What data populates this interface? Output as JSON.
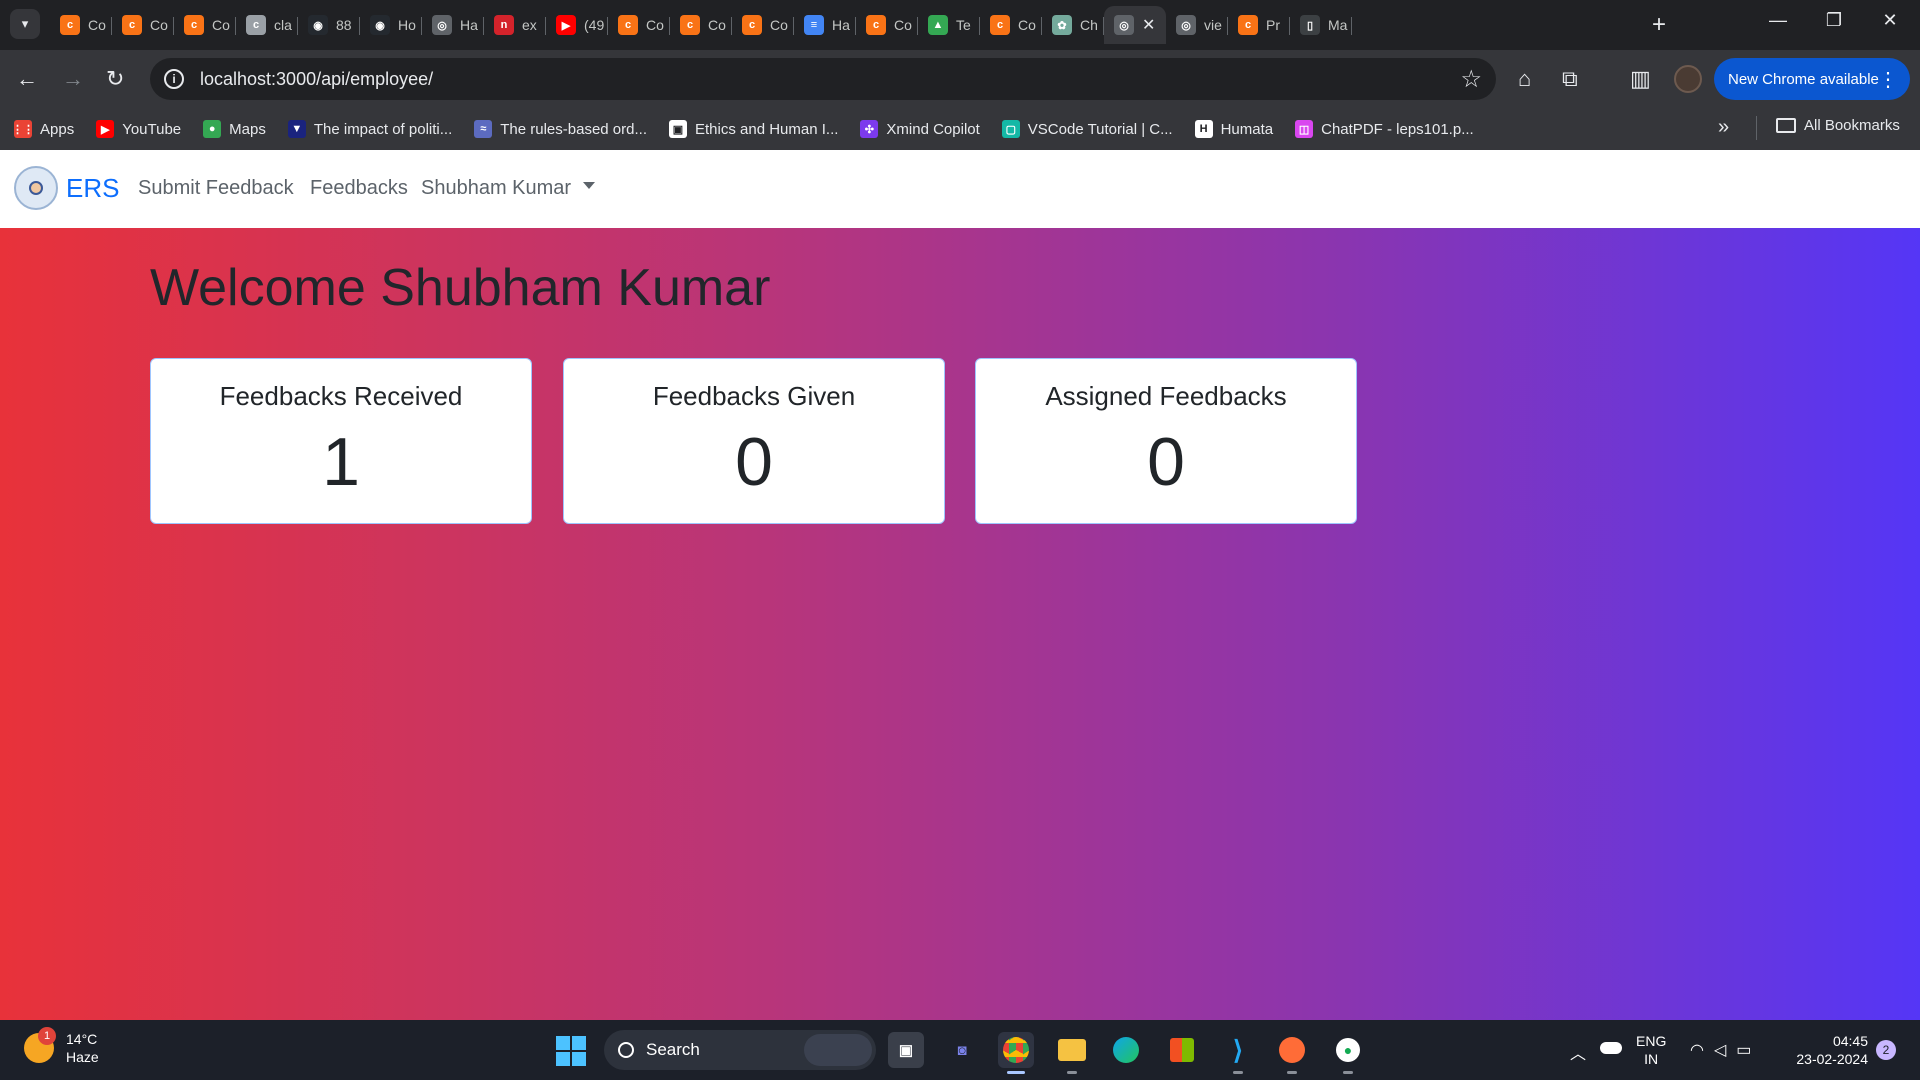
{
  "browser": {
    "tabs": [
      {
        "label": "Co",
        "fav_color": "#f97316",
        "fav_glyph": "c"
      },
      {
        "label": "Co",
        "fav_color": "#f97316",
        "fav_glyph": "c"
      },
      {
        "label": "Co",
        "fav_color": "#f97316",
        "fav_glyph": "c"
      },
      {
        "label": "cla",
        "fav_color": "#9aa0a6",
        "fav_glyph": "c"
      },
      {
        "label": "88",
        "fav_color": "#24292f",
        "fav_glyph": "◉"
      },
      {
        "label": "Ho",
        "fav_color": "#24292f",
        "fav_glyph": "◉"
      },
      {
        "label": "Ha",
        "fav_color": "#5f6368",
        "fav_glyph": "◎"
      },
      {
        "label": "ex",
        "fav_color": "#d4232b",
        "fav_glyph": "n"
      },
      {
        "label": "(49",
        "fav_color": "#ff0000",
        "fav_glyph": "▶"
      },
      {
        "label": "Co",
        "fav_color": "#f97316",
        "fav_glyph": "c"
      },
      {
        "label": "Co",
        "fav_color": "#f97316",
        "fav_glyph": "c"
      },
      {
        "label": "Co",
        "fav_color": "#f97316",
        "fav_glyph": "c"
      },
      {
        "label": "Ha",
        "fav_color": "#4285f4",
        "fav_glyph": "≡"
      },
      {
        "label": "Co",
        "fav_color": "#f97316",
        "fav_glyph": "c"
      },
      {
        "label": "Te",
        "fav_color": "#34a853",
        "fav_glyph": "▲"
      },
      {
        "label": "Co",
        "fav_color": "#f97316",
        "fav_glyph": "c"
      },
      {
        "label": "Ch",
        "fav_color": "#74aa9c",
        "fav_glyph": "✿"
      },
      {
        "label": "",
        "fav_color": "#5f6368",
        "fav_glyph": "◎",
        "active": true
      },
      {
        "label": "vie",
        "fav_color": "#5f6368",
        "fav_glyph": "◎"
      },
      {
        "label": "Pr",
        "fav_color": "#f97316",
        "fav_glyph": "c"
      },
      {
        "label": "Ma",
        "fav_color": "#3c4043",
        "fav_glyph": "▯"
      }
    ],
    "url": "localhost:3000/api/employee/",
    "update_button": "New Chrome available",
    "bookmarks": [
      {
        "label": "Apps",
        "fav_color": "#ea4335",
        "fav_glyph": "⋮⋮"
      },
      {
        "label": "YouTube",
        "fav_color": "#ff0000",
        "fav_glyph": "▶"
      },
      {
        "label": "Maps",
        "fav_color": "#34a853",
        "fav_glyph": "●"
      },
      {
        "label": "The impact of politi...",
        "fav_color": "#1a237e",
        "fav_glyph": "▼"
      },
      {
        "label": "The rules-based ord...",
        "fav_color": "#5c6bc0",
        "fav_glyph": "≈"
      },
      {
        "label": "Ethics and Human I...",
        "fav_color": "#ffffff",
        "fav_glyph": "▣"
      },
      {
        "label": "Xmind Copilot",
        "fav_color": "#7c3aed",
        "fav_glyph": "✣"
      },
      {
        "label": "VSCode Tutorial | C...",
        "fav_color": "#14b8a6",
        "fav_glyph": "▢"
      },
      {
        "label": "Humata",
        "fav_color": "#ffffff",
        "fav_glyph": "H"
      },
      {
        "label": "ChatPDF - leps101.p...",
        "fav_color": "#d946ef",
        "fav_glyph": "◫"
      }
    ],
    "all_bookmarks": "All Bookmarks"
  },
  "app": {
    "brand": "ERS",
    "nav": {
      "submit_feedback": "Submit Feedback",
      "feedbacks": "Feedbacks",
      "user": "Shubham Kumar"
    },
    "welcome": "Welcome Shubham Kumar",
    "cards": [
      {
        "title": "Feedbacks Received",
        "value": "1"
      },
      {
        "title": "Feedbacks Given",
        "value": "0"
      },
      {
        "title": "Assigned Feedbacks",
        "value": "0"
      }
    ]
  },
  "taskbar": {
    "weather_temp": "14°C",
    "weather_desc": "Haze",
    "weather_badge": "1",
    "search_label": "Search",
    "lang_line1": "ENG",
    "lang_line2": "IN",
    "time": "04:45",
    "date": "23-02-2024",
    "notification_count": "2"
  }
}
